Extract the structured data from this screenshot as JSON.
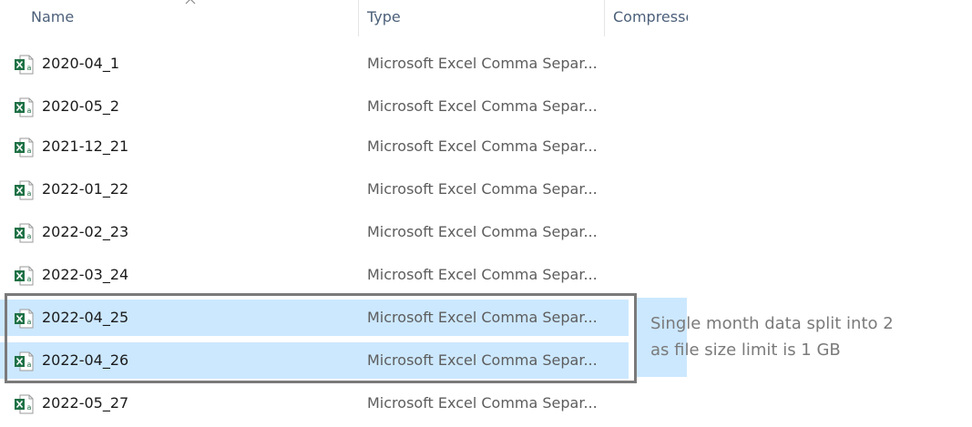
{
  "columns": {
    "name": "Name",
    "type": "Type",
    "compressed": "Compresse"
  },
  "files": [
    {
      "name": "2020-04_1",
      "type": "Microsoft Excel Comma Separ...",
      "icon": "excel-csv-icon",
      "selected": false
    },
    {
      "name": "2020-05_2",
      "type": "Microsoft Excel Comma Separ...",
      "icon": "excel-csv-icon",
      "selected": false
    },
    {
      "name": "2021-12_21",
      "type": "Microsoft Excel Comma Separ...",
      "icon": "excel-csv-icon",
      "selected": false
    },
    {
      "name": "2022-01_22",
      "type": "Microsoft Excel Comma Separ...",
      "icon": "excel-csv-icon",
      "selected": false
    },
    {
      "name": "2022-02_23",
      "type": "Microsoft Excel Comma Separ...",
      "icon": "excel-csv-icon",
      "selected": false
    },
    {
      "name": "2022-03_24",
      "type": "Microsoft Excel Comma Separ...",
      "icon": "excel-csv-icon",
      "selected": false
    },
    {
      "name": "2022-04_25",
      "type": "Microsoft Excel Comma Separ...",
      "icon": "excel-csv-icon",
      "selected": true
    },
    {
      "name": "2022-04_26",
      "type": "Microsoft Excel Comma Separ...",
      "icon": "excel-csv-icon",
      "selected": true
    },
    {
      "name": "2022-05_27",
      "type": "Microsoft Excel Comma Separ...",
      "icon": "excel-csv-icon",
      "selected": false
    }
  ],
  "annotation": {
    "line1": "Single month data split into 2",
    "line2": "as file size limit is 1 GB"
  },
  "colors": {
    "selection": "#cce8ff",
    "excel_green": "#1e7145",
    "highlight_border": "#7a7a7a",
    "header_text": "#4c607a"
  }
}
